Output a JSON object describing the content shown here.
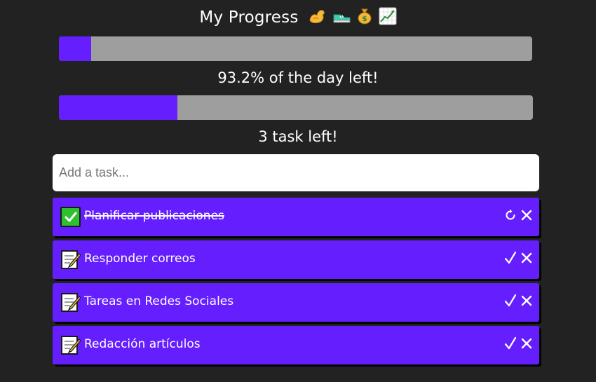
{
  "header": {
    "title": "My Progress",
    "emojis": "💪👟💰📈"
  },
  "day_progress": {
    "elapsed_percent": 6.8,
    "caption": "93.2% of the day left!"
  },
  "task_progress": {
    "completed_fraction": 0.25,
    "caption": "3 task left!"
  },
  "task_input": {
    "placeholder": "Add a task..."
  },
  "tasks": [
    {
      "label": "Planificar publicaciones",
      "done": true,
      "status_icon": "check-box-icon",
      "primary_action_icon": "undo-icon"
    },
    {
      "label": "Responder correos",
      "done": false,
      "status_icon": "memo-icon",
      "primary_action_icon": "check-icon"
    },
    {
      "label": "Tareas en Redes Sociales",
      "done": false,
      "status_icon": "memo-icon",
      "primary_action_icon": "check-icon"
    },
    {
      "label": "Redacción artículos",
      "done": false,
      "status_icon": "memo-icon",
      "primary_action_icon": "check-icon"
    }
  ],
  "colors": {
    "background": "#222222",
    "accent": "#651fff",
    "bar_track": "#9e9e9e",
    "done_check": "#2ec12e"
  }
}
